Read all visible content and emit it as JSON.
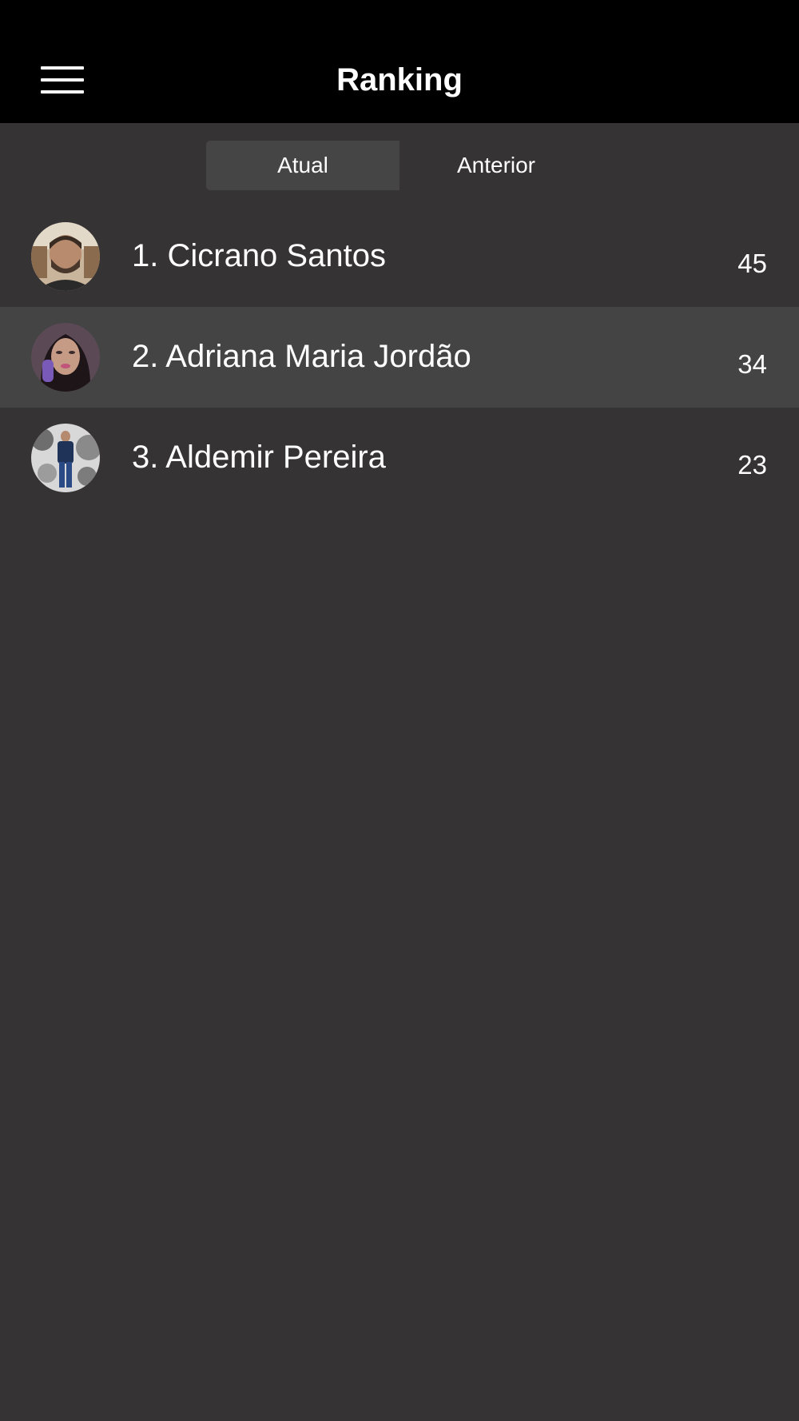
{
  "header": {
    "title": "Ranking",
    "menu_icon": "hamburger-menu-icon"
  },
  "segment": {
    "tabs": [
      {
        "label": "Atual",
        "selected": true
      },
      {
        "label": "Anterior",
        "selected": false
      }
    ]
  },
  "ranking": {
    "items": [
      {
        "label": "1. Cicrano Santos",
        "score": "45",
        "avatar": "user-photo-avatar"
      },
      {
        "label": "2. Adriana Maria Jordão",
        "score": "34",
        "avatar": "user-photo-avatar"
      },
      {
        "label": "3. Aldemir Pereira",
        "score": "23",
        "avatar": "user-photo-avatar"
      }
    ]
  },
  "colors": {
    "header_background": "#000000",
    "background": "#353334",
    "selected_tab": "#464546",
    "highlight_row": "#454445",
    "text": "#ffffff"
  }
}
